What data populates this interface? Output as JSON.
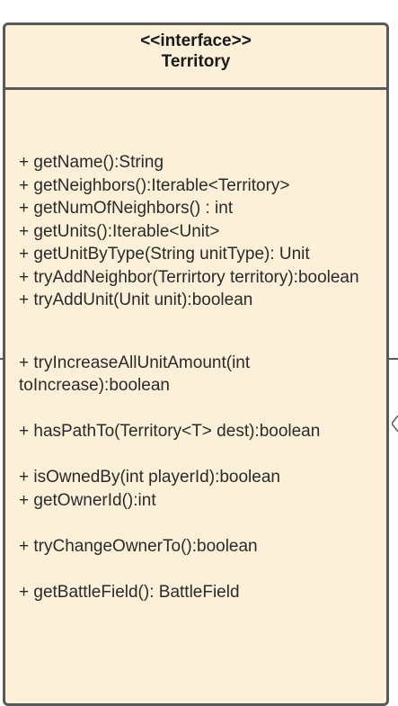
{
  "class_box": {
    "stereotype": "<<interface>>",
    "name": "Territory"
  },
  "methods_group_1": [
    "+ getName():String",
    "+ getNeighbors():Iterable<Territory>",
    "+ getNumOfNeighbors() : int",
    "+ getUnits():Iterable<Unit>",
    "+ getUnitByType(String unitType): Unit",
    "+ tryAddNeighbor(Terrirtory territory):boolean",
    "+ tryAddUnit(Unit unit):boolean"
  ],
  "methods_group_2": [
    "+ tryIncreaseAllUnitAmount(int toIncrease):boolean",
    "+ hasPathTo(Territory<T> dest):boolean",
    "+ isOwnedBy(int playerId):boolean",
    "+ getOwnerId():int",
    "+ tryChangeOwnerTo():boolean",
    "+ getBattleField(): BattleField"
  ],
  "colors": {
    "fill": "#fdf0d8",
    "border": "#595959",
    "text": "#2a2a2a"
  }
}
